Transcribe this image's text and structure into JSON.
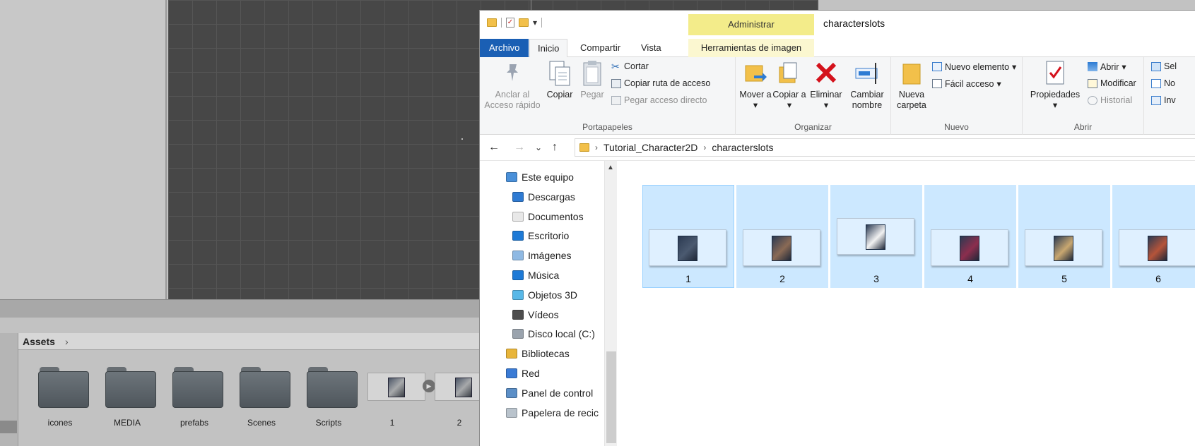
{
  "unity": {
    "assets_title": "Assets",
    "assets_items": [
      {
        "label": "icones",
        "kind": "folder"
      },
      {
        "label": "MEDIA",
        "kind": "folder"
      },
      {
        "label": "prefabs",
        "kind": "folder"
      },
      {
        "label": "Scenes",
        "kind": "folder"
      },
      {
        "label": "Scripts",
        "kind": "folder"
      },
      {
        "label": "1",
        "kind": "sprite"
      },
      {
        "label": "2",
        "kind": "sprite"
      }
    ]
  },
  "explorer": {
    "window_title": "characterslots",
    "contextual_tab_group": "Administrar",
    "tabs": [
      {
        "label": "Archivo"
      },
      {
        "label": "Inicio"
      },
      {
        "label": "Compartir"
      },
      {
        "label": "Vista"
      },
      {
        "label": "Herramientas de imagen"
      }
    ],
    "ribbon": {
      "portapapeles": {
        "label": "Portapapeles",
        "pin_label": "Anclar al Acceso rápido",
        "copy_label": "Copiar",
        "paste_label": "Pegar",
        "cut_label": "Cortar",
        "copy_path_label": "Copiar ruta de acceso",
        "paste_shortcut_label": "Pegar acceso directo"
      },
      "organizar": {
        "label": "Organizar",
        "move_label": "Mover a",
        "copy_to_label": "Copiar a",
        "delete_label": "Eliminar",
        "rename_label": "Cambiar nombre"
      },
      "nuevo": {
        "label": "Nuevo",
        "new_folder_label": "Nueva carpeta",
        "new_item_label": "Nuevo elemento",
        "easy_access_label": "Fácil acceso"
      },
      "abrir": {
        "label": "Abrir",
        "properties_label": "Propiedades",
        "open_label": "Abrir",
        "edit_label": "Modificar",
        "history_label": "Historial"
      },
      "seleccionar": {
        "select_all_label": "Sel",
        "select_none_label": "No",
        "invert_label": "Inv"
      }
    },
    "breadcrumb": [
      "Tutorial_Character2D",
      "characterslots"
    ],
    "nav_items": [
      {
        "label": "Este equipo",
        "icon": "computer-icon",
        "color": "#4a90d9",
        "indent": 0
      },
      {
        "label": "Descargas",
        "icon": "download-icon",
        "color": "#2f7bd3",
        "indent": 1
      },
      {
        "label": "Documentos",
        "icon": "document-icon",
        "color": "#e8e8e8",
        "indent": 1
      },
      {
        "label": "Escritorio",
        "icon": "desktop-icon",
        "color": "#1e7ad6",
        "indent": 1
      },
      {
        "label": "Imágenes",
        "icon": "pictures-icon",
        "color": "#8fb9e3",
        "indent": 1
      },
      {
        "label": "Música",
        "icon": "music-icon",
        "color": "#1e7ad6",
        "indent": 1
      },
      {
        "label": "Objetos 3D",
        "icon": "3d-objects-icon",
        "color": "#58b8e8",
        "indent": 1
      },
      {
        "label": "Vídeos",
        "icon": "videos-icon",
        "color": "#4d4d4d",
        "indent": 1
      },
      {
        "label": "Disco local (C:)",
        "icon": "drive-icon",
        "color": "#9aa3ad",
        "indent": 1
      },
      {
        "label": "Bibliotecas",
        "icon": "libraries-icon",
        "color": "#e8b53a",
        "indent": 0
      },
      {
        "label": "Red",
        "icon": "network-icon",
        "color": "#3a7bd5",
        "indent": 0
      },
      {
        "label": "Panel de control",
        "icon": "control-panel-icon",
        "color": "#5c8fc7",
        "indent": 0
      },
      {
        "label": "Papelera de recic",
        "icon": "recycle-bin-icon",
        "color": "#b9c3cc",
        "indent": 0
      }
    ],
    "files": [
      {
        "name": "1",
        "accent": "#4b5a70"
      },
      {
        "name": "2",
        "accent": "#8a6a55"
      },
      {
        "name": "3",
        "accent": "#f2f2f2"
      },
      {
        "name": "4",
        "accent": "#8c2e4e"
      },
      {
        "name": "5",
        "accent": "#c8a770"
      },
      {
        "name": "6",
        "accent": "#b5543a"
      }
    ]
  }
}
